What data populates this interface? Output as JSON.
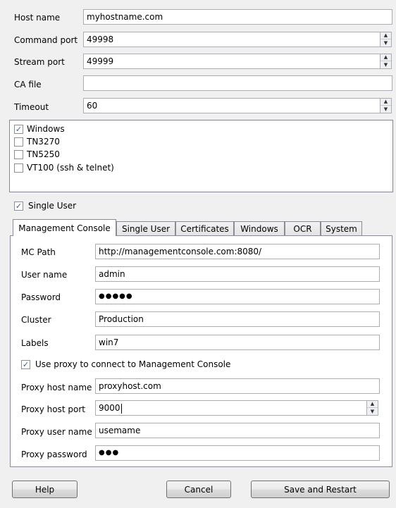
{
  "connection": {
    "host_name": {
      "label": "Host name",
      "value": "myhostname.com"
    },
    "command_port": {
      "label": "Command port",
      "value": "49998"
    },
    "stream_port": {
      "label": "Stream port",
      "value": "49999"
    },
    "ca_file": {
      "label": "CA file",
      "value": ""
    },
    "timeout": {
      "label": "Timeout",
      "value": "60"
    }
  },
  "terminal_types": [
    {
      "label": "Windows",
      "checked": true
    },
    {
      "label": "TN3270",
      "checked": false
    },
    {
      "label": "TN5250",
      "checked": false
    },
    {
      "label": "VT100 (ssh & telnet)",
      "checked": false
    }
  ],
  "single_user": {
    "label": "Single User",
    "checked": true
  },
  "tabs": [
    "Management Console",
    "Single User",
    "Certificates",
    "Windows",
    "OCR",
    "System"
  ],
  "active_tab": "Management Console",
  "mc": {
    "mc_path": {
      "label": "MC Path",
      "value": "http://managementconsole.com:8080/"
    },
    "user_name": {
      "label": "User name",
      "value": "admin"
    },
    "password": {
      "label": "Password",
      "value": "●●●●●"
    },
    "cluster": {
      "label": "Cluster",
      "value": "Production"
    },
    "labels": {
      "label": "Labels",
      "value": "win7"
    },
    "use_proxy": {
      "label": "Use proxy to connect to Management Console",
      "checked": true
    },
    "proxy_host_name": {
      "label": "Proxy host name",
      "value": "proxyhost.com"
    },
    "proxy_host_port": {
      "label": "Proxy host port",
      "value": "9000"
    },
    "proxy_user_name": {
      "label": "Proxy user name",
      "value": "usemame"
    },
    "proxy_password": {
      "label": "Proxy password",
      "value": "●●●"
    }
  },
  "buttons": {
    "help": "Help",
    "cancel": "Cancel",
    "save_restart": "Save and Restart"
  },
  "icons": {
    "spin_up": "▲",
    "spin_down": "▼",
    "check": "✓"
  }
}
